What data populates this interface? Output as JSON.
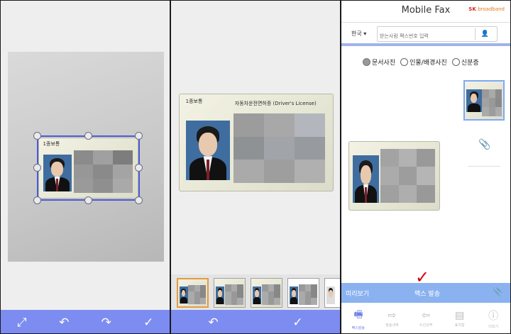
{
  "colors": {
    "accent_bar": "#7c8cf0",
    "crop_frame": "#4a5cd6",
    "send_bar": "#8bb2f0",
    "checkmark": "#d60000",
    "selected_thumb": "#e69a3e",
    "nav_active": "#6f7fe6"
  },
  "card": {
    "type_label": "1종보통",
    "title": "자동차운전면허증 (Driver's License)"
  },
  "panel1": {
    "toolbar_icons": [
      "expand-icon",
      "rotate-left-icon",
      "rotate-right-icon",
      "confirm-check-icon"
    ]
  },
  "panel2": {
    "toolbar_icons": [
      "rotate-left-icon",
      "confirm-check-icon"
    ],
    "thumbnail_count": 5,
    "selected_thumbnail": 1
  },
  "panel3": {
    "app_title": "Mobile Fax",
    "brand_logo": "SK broadband",
    "country_select": "한국",
    "fax_number_placeholder": "받는사람 팩스번호 입력",
    "doc_types": [
      {
        "label": "문서사진",
        "selected": true
      },
      {
        "label": "인물/배경사진",
        "selected": false
      },
      {
        "label": "신분증",
        "selected": false
      }
    ],
    "preview_button": "미리보기",
    "send_button": "팩스 발송",
    "nav": [
      {
        "label": "팩스발송",
        "active": true,
        "icon": "fax-icon"
      },
      {
        "label": "발송내역",
        "active": false,
        "icon": "sent-history-icon"
      },
      {
        "label": "수신내역",
        "active": false,
        "icon": "inbox-icon"
      },
      {
        "label": "표지함",
        "active": false,
        "icon": "cover-page-icon"
      },
      {
        "label": "더보기",
        "active": false,
        "icon": "more-info-icon"
      }
    ]
  }
}
